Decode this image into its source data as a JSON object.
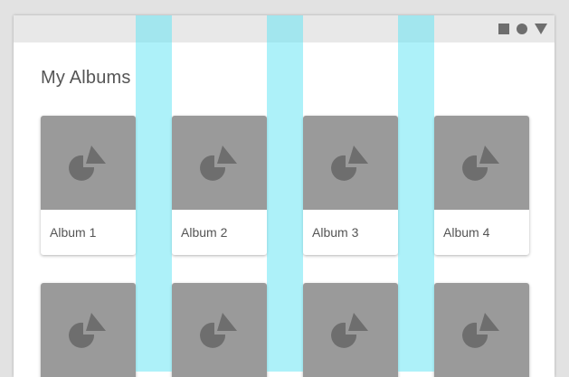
{
  "window": {
    "controls": [
      {
        "name": "square-icon"
      },
      {
        "name": "circle-icon"
      },
      {
        "name": "triangle-down-icon"
      }
    ]
  },
  "page": {
    "title": "My Albums"
  },
  "albums": [
    {
      "label": "Album 1"
    },
    {
      "label": "Album 2"
    },
    {
      "label": "Album 3"
    },
    {
      "label": "Album 4"
    }
  ],
  "colors": {
    "background": "#e2e2e2",
    "titlebar": "#e8e8e8",
    "thumbnail": "#9a9a9a",
    "placeholder_shape": "#6e6e6e",
    "gutter_overlay": "#5ce4f4",
    "text": "#555555"
  }
}
